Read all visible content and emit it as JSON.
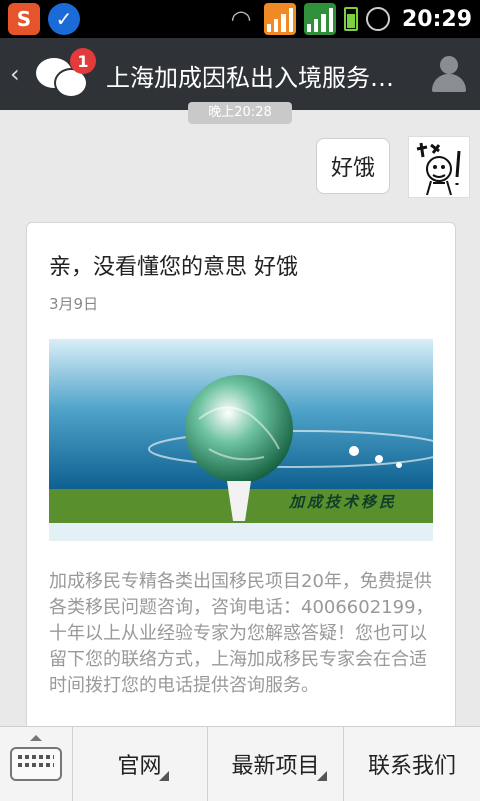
{
  "statusbar": {
    "time": "20:29",
    "icons": [
      "sogou-app-icon",
      "shield-app-icon",
      "wifi-icon",
      "signal-icon",
      "signal-icon",
      "battery-icon",
      "alarm-icon"
    ]
  },
  "header": {
    "badge_count": "1",
    "title": "上海加成因私出入境服务中心"
  },
  "chat": {
    "time_label": "晚上20:28",
    "user_message": "好饿"
  },
  "card": {
    "title": "亲，没看懂您的意思 好饿",
    "date": "3月9日",
    "image_caption": "加成技术移民",
    "body": "加成移民专精各类出国移民项目20年，免费提供各类移民问题咨询，咨询电话：4006602199，十年以上从业经验专家为您解惑答疑！您也可以留下您的联络方式，上海加成移民专家会在合适时间拨打您的电话提供咨询服务。"
  },
  "bottom_menu": {
    "items": [
      {
        "label": "官网"
      },
      {
        "label": "最新项目"
      },
      {
        "label": "联系我们"
      }
    ]
  },
  "colors": {
    "title_bar": "#2f3338",
    "badge": "#e33b3b",
    "background": "#e9e9e9"
  }
}
